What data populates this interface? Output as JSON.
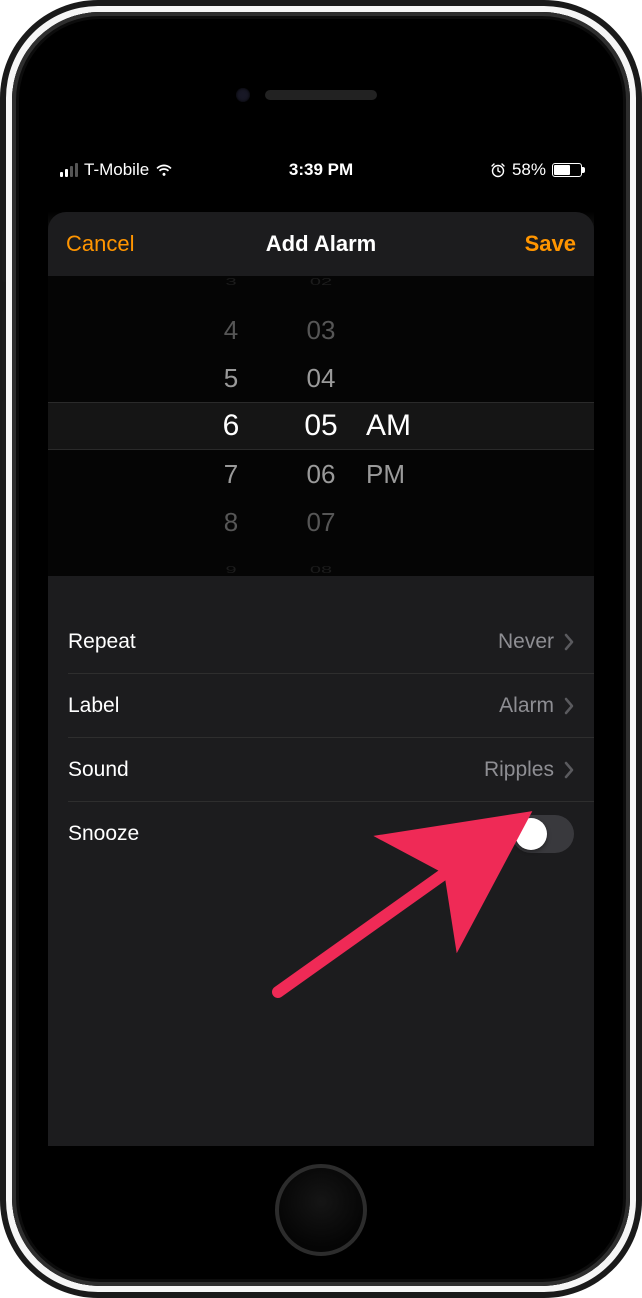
{
  "status_bar": {
    "carrier": "T-Mobile",
    "time": "3:39 PM",
    "battery_percent": "58%"
  },
  "nav": {
    "cancel": "Cancel",
    "title": "Add Alarm",
    "save": "Save"
  },
  "picker": {
    "hours": [
      "3",
      "4",
      "5",
      "6",
      "7",
      "8",
      "9"
    ],
    "minutes": [
      "02",
      "03",
      "04",
      "05",
      "06",
      "07",
      "08"
    ],
    "ampm": [
      "AM",
      "PM"
    ],
    "selected_hour": "6",
    "selected_minute": "05",
    "selected_ampm": "AM"
  },
  "rows": {
    "repeat_label": "Repeat",
    "repeat_value": "Never",
    "label_label": "Label",
    "label_value": "Alarm",
    "sound_label": "Sound",
    "sound_value": "Ripples",
    "snooze_label": "Snooze",
    "snooze_on": false
  }
}
